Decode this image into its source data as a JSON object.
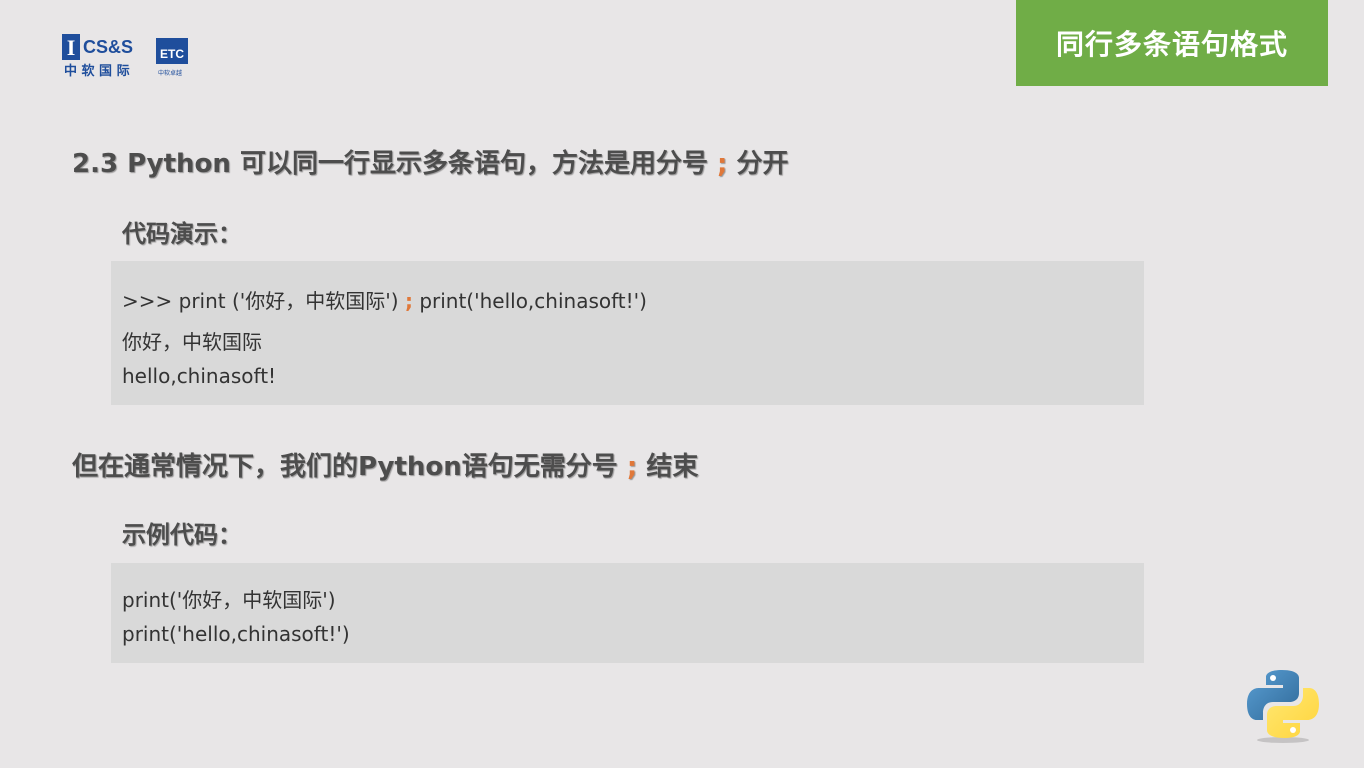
{
  "header": {
    "logo_text_top": "CS&S",
    "logo_text_mid": "ETC",
    "logo_text_bottom": "中 软 国 际",
    "logo_text_small": "中软卓越",
    "slide_title": "同行多条语句格式"
  },
  "section1": {
    "heading_prefix": "2.3 Python 可以同一行显示多条语句，方法是用分号",
    "heading_semicolon": ";",
    "heading_suffix": "分开",
    "subheading": "代码演示：",
    "code": {
      "line1_prefix": ">>> print ('你好，中软国际')",
      "line1_semicolon": ";",
      "line1_suffix": "print('hello,chinasoft!')",
      "line2": "你好，中软国际",
      "line3": "hello,chinasoft!"
    }
  },
  "section2": {
    "heading_prefix": "但在通常情况下，我们的Python语句无需分号",
    "heading_semicolon": ";",
    "heading_suffix": "结束",
    "subheading": "示例代码：",
    "code": {
      "line1": "print('你好，中软国际')",
      "line2": "print('hello,chinasoft!')"
    }
  },
  "colors": {
    "title_bg": "#70ad47",
    "accent_semicolon": "#e0783a",
    "code_bg": "#d9d9d9",
    "page_bg": "#e8e6e7"
  },
  "icons": [
    "company-logo",
    "python-logo-icon"
  ]
}
